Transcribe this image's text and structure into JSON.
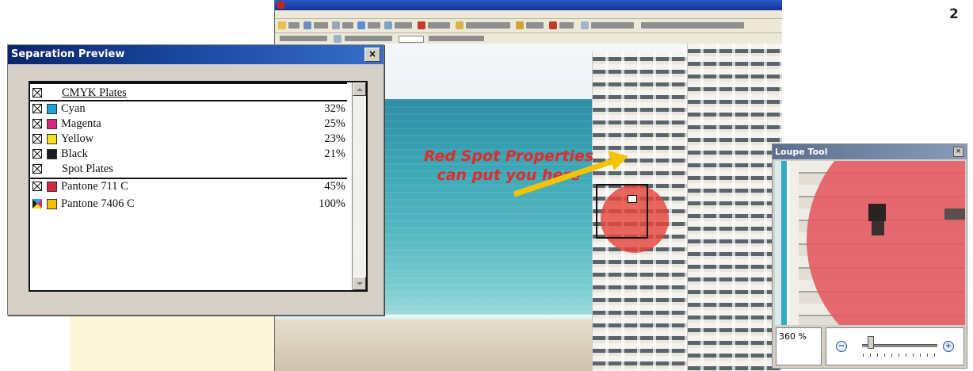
{
  "page": {
    "number": "2"
  },
  "separation_preview": {
    "title": "Separation Preview",
    "close": "×",
    "rows": [
      {
        "kind": "group",
        "label": "CMYK Plates",
        "percent": "",
        "checked": true,
        "swatch": null
      },
      {
        "kind": "plate",
        "label": "Cyan",
        "percent": "32%",
        "checked": true,
        "swatch": "#1ea3dc"
      },
      {
        "kind": "plate",
        "label": "Magenta",
        "percent": "25%",
        "checked": true,
        "swatch": "#d8287a"
      },
      {
        "kind": "plate",
        "label": "Yellow",
        "percent": "23%",
        "checked": true,
        "swatch": "#f7e11a"
      },
      {
        "kind": "plate",
        "label": "Black",
        "percent": "21%",
        "checked": true,
        "swatch": "#1a1a1a"
      },
      {
        "kind": "group",
        "label": "Spot Plates",
        "percent": "",
        "checked": true,
        "swatch": null
      },
      {
        "kind": "plate",
        "label": "Pantone 711 C",
        "percent": "45%",
        "checked": true,
        "swatch": "#d7283e"
      },
      {
        "kind": "plate",
        "label": "Pantone 7406 C",
        "percent": "100%",
        "checked": false,
        "swatch": "#f5c000"
      }
    ]
  },
  "promo": {
    "line1": "Red Spot Properties",
    "line2": "can put you here"
  },
  "loupe_tool": {
    "title": "Loupe Tool",
    "close": "×",
    "zoom_label": "360 %",
    "zoom_out": "−",
    "zoom_in": "+",
    "zoom_level": 0.12
  },
  "colors": {
    "promo_text": "#e22a2a",
    "spot_red": "#e6463c",
    "arrow": "#f5c400"
  }
}
